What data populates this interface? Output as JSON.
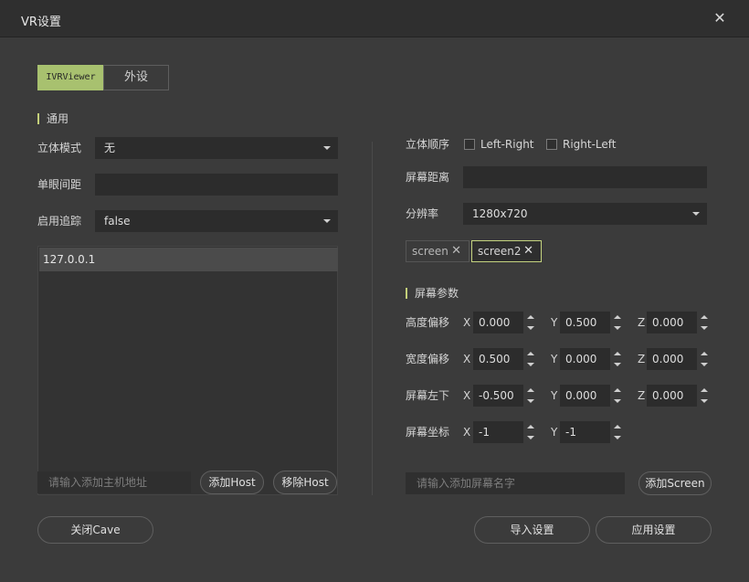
{
  "window": {
    "title": "VR设置",
    "close_icon": "close-icon"
  },
  "tabs": [
    {
      "label": "IVRViewer",
      "active": true
    },
    {
      "label": "外设",
      "active": false
    }
  ],
  "left": {
    "section_title": "通用",
    "stereo_mode": {
      "label": "立体模式",
      "value": "无"
    },
    "eye_distance": {
      "label": "单眼间距",
      "value": ""
    },
    "tracking": {
      "label": "启用追踪",
      "value": "false"
    },
    "hosts": [
      "127.0.0.1"
    ],
    "host_input_placeholder": "请输入添加主机地址",
    "add_host": "添加Host",
    "remove_host": "移除Host"
  },
  "right": {
    "stereo_order": {
      "label": "立体顺序",
      "options": [
        "Left-Right",
        "Right-Left"
      ]
    },
    "screen_distance": {
      "label": "屏幕距离",
      "value": ""
    },
    "resolution": {
      "label": "分辨率",
      "value": "1280x720"
    },
    "screens": [
      {
        "name": "screen",
        "selected": false
      },
      {
        "name": "screen2",
        "selected": true
      }
    ],
    "section_title": "屏幕参数",
    "rows": [
      {
        "label": "高度偏移",
        "x": "0.000",
        "y": "0.500",
        "z": "0.000"
      },
      {
        "label": "宽度偏移",
        "x": "0.500",
        "y": "0.000",
        "z": "0.000"
      },
      {
        "label": "屏幕左下",
        "x": "-0.500",
        "y": "0.000",
        "z": "0.000"
      },
      {
        "label": "屏幕坐标",
        "x": "-1",
        "y": "-1"
      }
    ],
    "axis": {
      "x": "X",
      "y": "Y",
      "z": "Z"
    },
    "screen_input_placeholder": "请输入添加屏幕名字",
    "add_screen": "添加Screen"
  },
  "footer": {
    "close_cave": "关闭Cave",
    "import": "导入设置",
    "apply": "应用设置"
  },
  "colors": {
    "accent": "#a8c16f",
    "background": "#3b3b3b",
    "titlebar": "#2f2f2f"
  }
}
